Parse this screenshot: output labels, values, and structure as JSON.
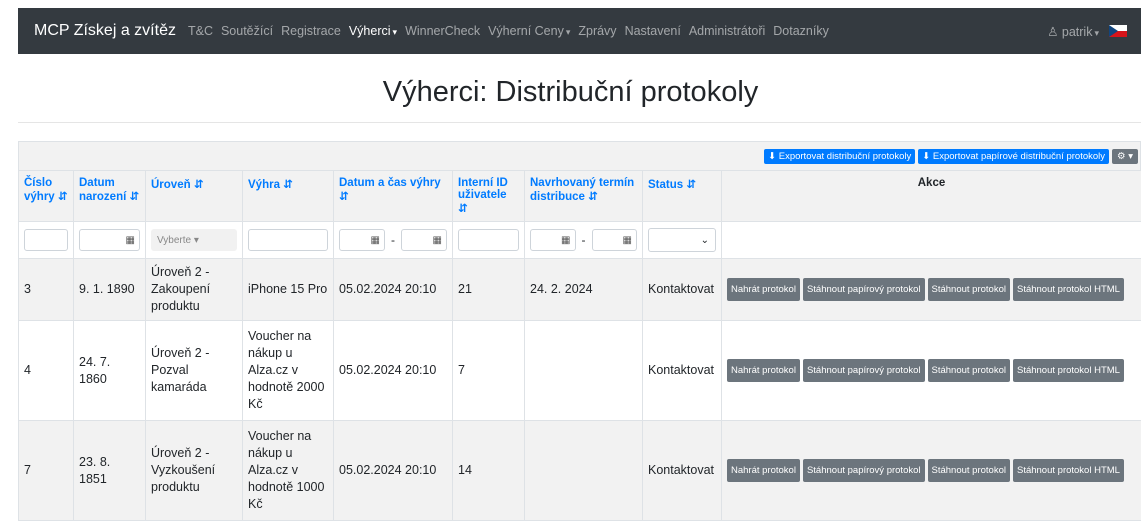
{
  "navbar": {
    "brand": "MCP Získej a zvítěz",
    "items": [
      {
        "label": "T&C",
        "active": false,
        "dropdown": false
      },
      {
        "label": "Soutěžící",
        "active": false,
        "dropdown": false
      },
      {
        "label": "Registrace",
        "active": false,
        "dropdown": false
      },
      {
        "label": "Výherci",
        "active": true,
        "dropdown": true
      },
      {
        "label": "WinnerCheck",
        "active": false,
        "dropdown": false
      },
      {
        "label": "Výherní Ceny",
        "active": false,
        "dropdown": true
      },
      {
        "label": "Zprávy",
        "active": false,
        "dropdown": false
      },
      {
        "label": "Nastavení",
        "active": false,
        "dropdown": false
      },
      {
        "label": "Administrátoři",
        "active": false,
        "dropdown": false
      },
      {
        "label": "Dotazníky",
        "active": false,
        "dropdown": false
      }
    ],
    "user": "patrik",
    "user_icon": "user-icon",
    "flag": "czech-flag"
  },
  "page": {
    "title": "Výherci: Distribuční protokoly"
  },
  "toolbar": {
    "export_distribution": "Exportovat distribuční protokoly",
    "export_paper": "Exportovat papírové distribuční protokoly",
    "settings_icon": "gear-icon"
  },
  "table": {
    "headers": [
      {
        "label": "Číslo výhry",
        "sortable": true
      },
      {
        "label": "Datum narození",
        "sortable": true
      },
      {
        "label": "Úroveň",
        "sortable": true
      },
      {
        "label": "Výhra",
        "sortable": true
      },
      {
        "label": "Datum a čas výhry",
        "sortable": true
      },
      {
        "label": "Interní ID uživatele",
        "sortable": true
      },
      {
        "label": "Navrhovaný termín distribuce",
        "sortable": true
      },
      {
        "label": "Status",
        "sortable": true
      },
      {
        "label": "Akce",
        "sortable": false
      }
    ],
    "filters": {
      "level_placeholder": "Vyberte"
    },
    "rows": [
      {
        "number": "3",
        "birth": "9. 1. 1890",
        "level": "Úroveň 2 - Zakoupení produktu",
        "prize": "iPhone 15 Pro",
        "datetime": "05.02.2024 20:10",
        "user_id": "21",
        "distribution": "24. 2. 2024",
        "status": "Kontaktovat"
      },
      {
        "number": "4",
        "birth": "24. 7. 1860",
        "level": "Úroveň 2 - Pozval kamaráda",
        "prize": "Voucher na nákup u Alza.cz v hodnotě 2000 Kč",
        "datetime": "05.02.2024 20:10",
        "user_id": "7",
        "distribution": "",
        "status": "Kontaktovat"
      },
      {
        "number": "7",
        "birth": "23. 8. 1851",
        "level": "Úroveň 2 - Vyzkoušení produktu",
        "prize": "Voucher na nákup u Alza.cz v hodnotě 1000 Kč",
        "datetime": "05.02.2024 20:10",
        "user_id": "14",
        "distribution": "",
        "status": "Kontaktovat"
      }
    ],
    "actions": [
      "Nahrát protokol",
      "Stáhnout papírový protokol",
      "Stáhnout protokol",
      "Stáhnout protokol HTML"
    ]
  }
}
